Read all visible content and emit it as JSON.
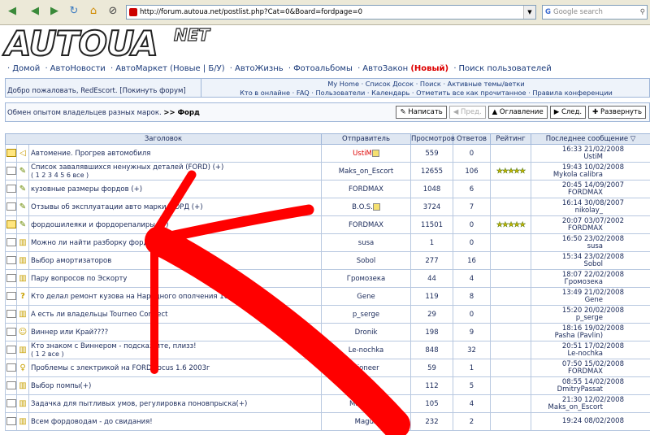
{
  "browser": {
    "url": "http://forum.autoua.net/postlist.php?Cat=0&Board=fordpage=0",
    "search_placeholder": "Google search",
    "search_engine": "G"
  },
  "logo": {
    "main": "AUTOUA",
    "sup": "NET"
  },
  "nav": {
    "items": [
      {
        "label": "Домой"
      },
      {
        "label": "АвтоНовости"
      },
      {
        "label": "АвтоМаркет (Новые | Б/У)"
      },
      {
        "label": "АвтоЖизнь"
      },
      {
        "label": "Фотоальбомы"
      },
      {
        "label": "АвтоЗакон",
        "badge": "(Новый)"
      },
      {
        "label": "Поиск пользователей"
      }
    ]
  },
  "welcome": {
    "text": "Добро пожаловать, RedEscort. [Покинуть форум]",
    "links_line1": "My Home · Список Досок · Поиск · Активные темы/ветки",
    "links_line2": "Кто в онлайне · FAQ · Пользователи · Календарь · Отметить все как прочитанное · Правила конференции"
  },
  "crumb": {
    "desc": "Обмен опытом владельцев разных марок.",
    "current": ">> Форд",
    "buttons": {
      "write": "Написать",
      "prev": "Пред.",
      "contents": "Оглавление",
      "next": "След.",
      "expand": "Развернуть"
    }
  },
  "table": {
    "headers": {
      "title": "Заголовок",
      "author": "Отправитель",
      "views": "Просмотров",
      "replies": "Ответов",
      "rating": "Рейтинг",
      "last": "Последнее сообщение ▽"
    },
    "rows": [
      {
        "title": "Автомение. Прогрев автомобиля",
        "author": "UstiM",
        "author_red": true,
        "views": "559",
        "replies": "0",
        "rating": "",
        "last_date": "16:33 21/02/2008",
        "last_user": "UstiM",
        "icon": "sound-icon",
        "hot": true
      },
      {
        "title": "Список завалявшихся ненужных деталей (FORD) (+)",
        "pages": "( 1 2 3 4 5 6 все )",
        "author": "Maks_on_Escort",
        "views": "12655",
        "replies": "106",
        "rating": "★★★★★",
        "last_date": "19:43 10/02/2008",
        "last_user": "Mykola calibra",
        "icon": "pencil-icon",
        "hot": false
      },
      {
        "title": "кузовные размеры фордов (+)",
        "author": "FORDMAX",
        "views": "1048",
        "replies": "6",
        "rating": "",
        "last_date": "20:45 14/09/2007",
        "last_user": "FORDMAX",
        "icon": "pencil-icon",
        "hot": false
      },
      {
        "title": "Отзывы об эксплуатации авто марки ФОРД (+)",
        "author": "B.O.S.",
        "author_mark": true,
        "views": "3724",
        "replies": "7",
        "rating": "",
        "last_date": "16:14 30/08/2007",
        "last_user": "nikolay_",
        "icon": "pencil-icon",
        "hot": false
      },
      {
        "title": "фордошилеяки и фордорепалиры (+)",
        "author": "FORDMAX",
        "views": "11501",
        "replies": "0",
        "rating": "★★★★★",
        "last_date": "20:07 03/07/2002",
        "last_user": "FORDMAX",
        "icon": "pencil-icon",
        "hot": true
      },
      {
        "title": "Можно ли найти разборку форда?",
        "author": "susa",
        "views": "1",
        "replies": "0",
        "rating": "",
        "last_date": "16:50 23/02/2008",
        "last_user": "susa",
        "icon": "book-icon",
        "hot": false
      },
      {
        "title": "Выбор амортизаторов",
        "author": "Sobol",
        "views": "277",
        "replies": "16",
        "rating": "",
        "last_date": "15:34 23/02/2008",
        "last_user": "Sobol",
        "icon": "book-icon",
        "hot": false
      },
      {
        "title": "Пару вопросов по Эскорту",
        "author": "Громозека",
        "views": "44",
        "replies": "4",
        "rating": "",
        "last_date": "18:07 22/02/2008",
        "last_user": "Громозека",
        "icon": "book-icon",
        "hot": false
      },
      {
        "title": "Кто делал ремонт кузова на Народного ополчения 16-а",
        "author": "Gene",
        "views": "119",
        "replies": "8",
        "rating": "",
        "last_date": "13:49 21/02/2008",
        "last_user": "Gene",
        "icon": "question-icon",
        "hot": false
      },
      {
        "title": "А есть ли владельцы Tourneo Connect",
        "author": "p_serge",
        "views": "29",
        "replies": "0",
        "rating": "",
        "last_date": "15:20 20/02/2008",
        "last_user": "p_serge",
        "icon": "book-icon",
        "hot": false
      },
      {
        "title": "Виннер или Край????",
        "author": "Dronik",
        "views": "198",
        "replies": "9",
        "rating": "",
        "last_date": "18:16 19/02/2008",
        "last_user": "Pasha (Pavlin)",
        "icon": "smile-icon",
        "hot": false
      },
      {
        "title": "Кто знаком с Виннером - подскажите, плизз!",
        "pages": "( 1 2 все )",
        "author": "Le-nochka",
        "views": "848",
        "replies": "32",
        "rating": "",
        "last_date": "20:51 17/02/2008",
        "last_user": "Le-nochka",
        "icon": "book-icon",
        "hot": false
      },
      {
        "title": "Проблемы с электрикой на FORD Focus 1.6 2003г",
        "author": "pioneer",
        "views": "59",
        "replies": "1",
        "rating": "",
        "last_date": "07:50 15/02/2008",
        "last_user": "FORDMAX",
        "icon": "bulb-icon",
        "hot": false
      },
      {
        "title": "Выбор помпы(+)",
        "author": "",
        "views": "112",
        "replies": "5",
        "rating": "",
        "last_date": "08:55 14/02/2008",
        "last_user": "DmitryPassat",
        "icon": "book-icon",
        "hot": false
      },
      {
        "title": "Задачка для пытливых умов, регулировка поновпрыска(+)",
        "author": "Maks_on_",
        "views": "105",
        "replies": "4",
        "rating": "",
        "last_date": "21:30 12/02/2008",
        "last_user": "Maks_on_Escort",
        "icon": "book-icon",
        "hot": false
      },
      {
        "title": "Всем фордоводам - до свидания!",
        "author": "Magus",
        "views": "232",
        "replies": "2",
        "rating": "",
        "last_date": "19:24 08/02/2008",
        "last_user": "",
        "icon": "book-icon",
        "hot": false
      }
    ]
  },
  "colors": {
    "accent": "#1a3a7a",
    "header_bg": "#dfe7f2",
    "border": "#9fb6d8",
    "arrow": "#ff0000",
    "stars": "#ccb800"
  }
}
